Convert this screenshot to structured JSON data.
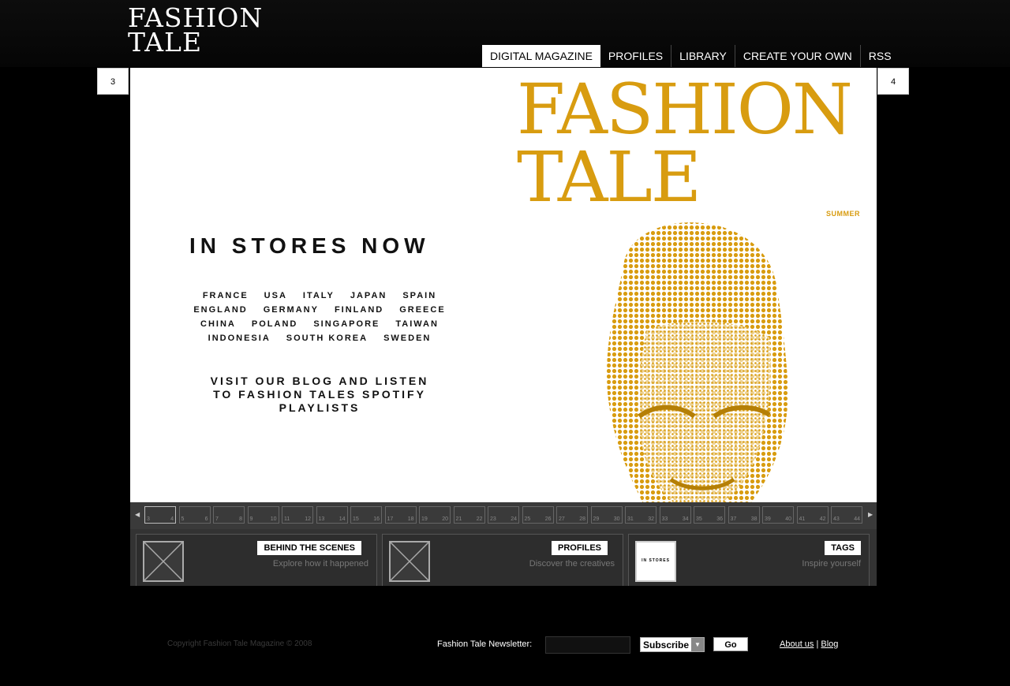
{
  "site": {
    "logo_line1": "FASHION",
    "logo_line2": "TALE"
  },
  "nav": {
    "items": [
      {
        "label": "DIGITAL MAGAZINE"
      },
      {
        "label": "PROFILES"
      },
      {
        "label": "LIBRARY"
      },
      {
        "label": "CREATE YOUR OWN"
      },
      {
        "label": "RSS"
      }
    ]
  },
  "viewer": {
    "left_page": "3",
    "right_page": "4"
  },
  "spread": {
    "mag_title_line1": "FASHION",
    "mag_title_line2": "TALE",
    "issue": "SUMMER",
    "headline": "IN STORES NOW",
    "country_rows": [
      [
        "FRANCE",
        "USA",
        "ITALY",
        "JAPAN",
        "SPAIN"
      ],
      [
        "ENGLAND",
        "GERMANY",
        "FINLAND",
        "GREECE"
      ],
      [
        "CHINA",
        "POLAND",
        "SINGAPORE",
        "TAIWAN"
      ],
      [
        "INDONESIA",
        "SOUTH KOREA",
        "SWEDEN"
      ]
    ],
    "blog_line1": "VISIT OUR BLOG AND LISTEN",
    "blog_line2": "TO FASHION TALES SPOTIFY",
    "blog_line3": "PLAYLISTS"
  },
  "thumbnails": {
    "pages": [
      "3",
      "4",
      "5",
      "6",
      "7",
      "8",
      "9",
      "10",
      "11",
      "12",
      "13",
      "14",
      "15",
      "16",
      "17",
      "18",
      "19",
      "20",
      "21",
      "22",
      "23",
      "24",
      "25",
      "26",
      "27",
      "28",
      "29",
      "30",
      "31",
      "32",
      "33",
      "34",
      "35",
      "36",
      "37",
      "38",
      "39",
      "40",
      "41",
      "42",
      "43",
      "44"
    ]
  },
  "panels": [
    {
      "label": "BEHIND THE SCENES",
      "sub": "Explore how it happened"
    },
    {
      "label": "PROFILES",
      "sub": "Discover the creatives"
    },
    {
      "label": "TAGS",
      "sub": "Inspire yourself",
      "thumb_text": "IN STORES"
    }
  ],
  "footer": {
    "copyright": "Copyright Fashion Tale Magazine © 2008",
    "newsletter_label": "Fashion Tale Newsletter:",
    "subscribe_option": "Subscribe",
    "go_label": "Go",
    "about_link": "About us",
    "separator": "|",
    "blog_link": "Blog"
  },
  "colors": {
    "accent": "#d89c10",
    "background": "#000000"
  }
}
